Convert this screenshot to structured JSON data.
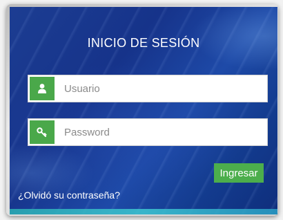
{
  "login": {
    "title": "INICIO DE SESIÓN",
    "username": {
      "placeholder": "Usuario",
      "value": "",
      "icon": "user-icon"
    },
    "password": {
      "placeholder": "Password",
      "value": "",
      "icon": "key-icon"
    },
    "submit_label": "Ingresar",
    "forgot_label": "¿Olvidó su contraseña?"
  },
  "colors": {
    "accent_green": "#4cae4c",
    "panel_blue": "#1c3d92",
    "text_white": "#ffffff"
  }
}
